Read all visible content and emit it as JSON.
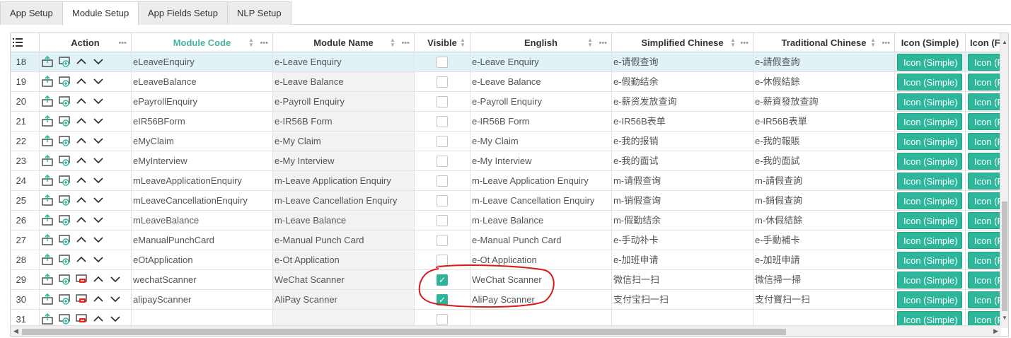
{
  "tabs": [
    {
      "label": "App Setup",
      "active": false
    },
    {
      "label": "Module Setup",
      "active": true
    },
    {
      "label": "App Fields Setup",
      "active": false
    },
    {
      "label": "NLP Setup",
      "active": false
    }
  ],
  "grid": {
    "columns": {
      "action": "Action",
      "module_code": "Module Code",
      "module_name": "Module Name",
      "visible": "Visible",
      "english": "English",
      "simplified_chinese": "Simplified Chinese",
      "traditional_chinese": "Traditional Chinese",
      "icon_simple": "Icon (Simple)",
      "icon_fast": "Icon (Fas"
    },
    "icon_button_label": "Icon (Simple)",
    "icon_button_label_cut": "Icon (F",
    "rows": [
      {
        "num": "18",
        "code": "eLeaveEnquiry",
        "name": "e-Leave Enquiry",
        "visible": false,
        "english": "e-Leave Enquiry",
        "sc": "e-请假查询",
        "tc": "e-請假查詢",
        "delete": false,
        "highlight": true
      },
      {
        "num": "19",
        "code": "eLeaveBalance",
        "name": "e-Leave Balance",
        "visible": false,
        "english": "e-Leave Balance",
        "sc": "e-假勤结余",
        "tc": "e-休假結餘",
        "delete": false
      },
      {
        "num": "20",
        "code": "ePayrollEnquiry",
        "name": "e-Payroll Enquiry",
        "visible": false,
        "english": "e-Payroll Enquiry",
        "sc": "e-薪资发放查询",
        "tc": "e-薪資發放查詢",
        "delete": false
      },
      {
        "num": "21",
        "code": "eIR56BForm",
        "name": "e-IR56B Form",
        "visible": false,
        "english": "e-IR56B Form",
        "sc": "e-IR56B表单",
        "tc": "e-IR56B表單",
        "delete": false
      },
      {
        "num": "22",
        "code": "eMyClaim",
        "name": "e-My Claim",
        "visible": false,
        "english": "e-My Claim",
        "sc": "e-我的报销",
        "tc": "e-我的報賬",
        "delete": false
      },
      {
        "num": "23",
        "code": "eMyInterview",
        "name": "e-My Interview",
        "visible": false,
        "english": "e-My Interview",
        "sc": "e-我的面试",
        "tc": "e-我的面試",
        "delete": false
      },
      {
        "num": "24",
        "code": "mLeaveApplicationEnquiry",
        "name": "m-Leave Application Enquiry",
        "visible": false,
        "english": "m-Leave Application Enquiry",
        "sc": "m-请假查询",
        "tc": "m-請假查詢",
        "delete": false
      },
      {
        "num": "25",
        "code": "mLeaveCancellationEnquiry",
        "name": "m-Leave Cancellation Enquiry",
        "visible": false,
        "english": "m-Leave Cancellation Enquiry",
        "sc": "m-销假查询",
        "tc": "m-銷假查詢",
        "delete": false
      },
      {
        "num": "26",
        "code": "mLeaveBalance",
        "name": "m-Leave Balance",
        "visible": false,
        "english": "m-Leave Balance",
        "sc": "m-假勤结余",
        "tc": "m-休假結餘",
        "delete": false
      },
      {
        "num": "27",
        "code": "eManualPunchCard",
        "name": "e-Manual Punch Card",
        "visible": false,
        "english": "e-Manual Punch Card",
        "sc": "e-手动补卡",
        "tc": "e-手動補卡",
        "delete": false
      },
      {
        "num": "28",
        "code": "eOtApplication",
        "name": "e-Ot Application",
        "visible": false,
        "english": "e-Ot Application",
        "sc": "e-加班申请",
        "tc": "e-加班申請",
        "delete": false
      },
      {
        "num": "29",
        "code": "wechatScanner",
        "name": "WeChat Scanner",
        "visible": true,
        "english": "WeChat Scanner",
        "sc": "微信扫一扫",
        "tc": "微信掃一掃",
        "delete": true
      },
      {
        "num": "30",
        "code": "alipayScanner",
        "name": "AliPay Scanner",
        "visible": true,
        "english": "AliPay Scanner",
        "sc": "支付宝扫一扫",
        "tc": "支付寶扫一扫",
        "delete": true
      },
      {
        "num": "31",
        "code": "",
        "name": "",
        "visible": false,
        "english": "",
        "sc": "",
        "tc": "",
        "delete": true
      }
    ]
  },
  "colors": {
    "accent": "#2eb69a",
    "header_teal": "#43b39b",
    "row_highlight": "#e1f2f7",
    "annotation": "#d9191c"
  },
  "icons": {
    "column_chooser": "list-columns-icon",
    "export": "export-icon",
    "add": "add-row-icon",
    "delete": "delete-row-icon",
    "move_up": "chevron-up-icon",
    "move_down": "chevron-down-icon"
  }
}
